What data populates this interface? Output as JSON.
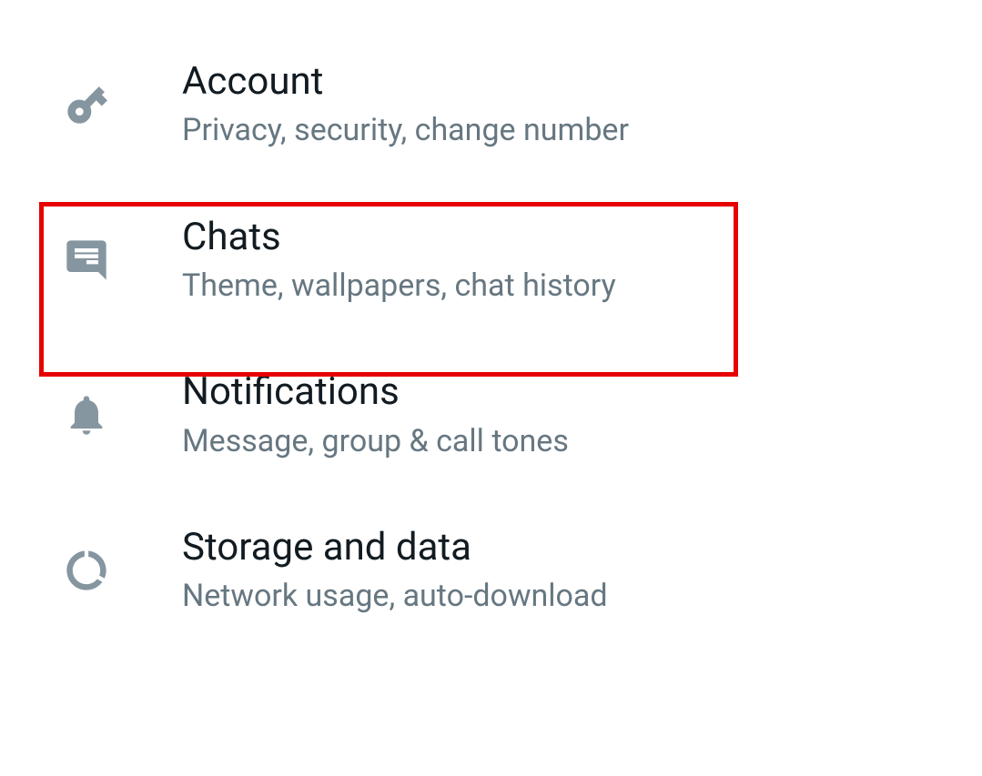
{
  "settings": {
    "items": [
      {
        "title": "Account",
        "subtitle": "Privacy, security, change number"
      },
      {
        "title": "Chats",
        "subtitle": "Theme, wallpapers, chat history"
      },
      {
        "title": "Notifications",
        "subtitle": "Message, group & call tones"
      },
      {
        "title": "Storage and data",
        "subtitle": "Network usage, auto-download"
      }
    ]
  },
  "colors": {
    "icon": "#8696a0",
    "title": "#111b21",
    "subtitle": "#667781",
    "highlight": "#e60000"
  }
}
